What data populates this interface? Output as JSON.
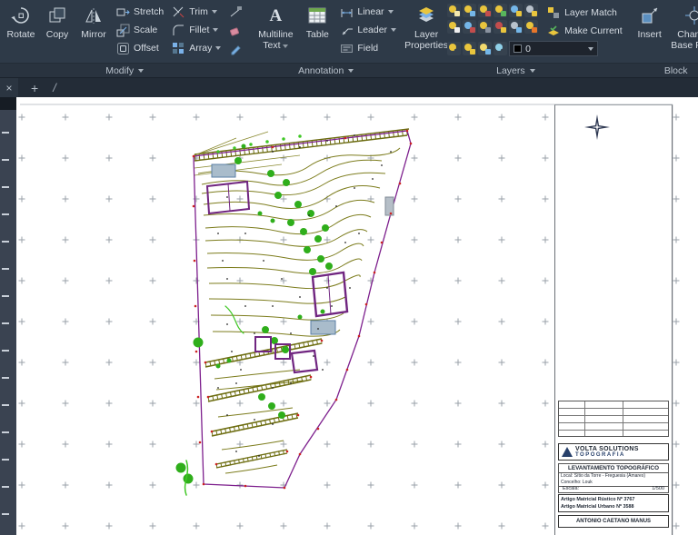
{
  "ribbon": {
    "modify": {
      "label": "Modify",
      "rotate": "Rotate",
      "copy": "Copy",
      "mirror": "Mirror",
      "stretch": "Stretch",
      "scale": "Scale",
      "offset": "Offset",
      "trim": "Trim",
      "fillet": "Fillet",
      "array": "Array"
    },
    "annotation": {
      "label": "Annotation",
      "multiline1": "Multiline",
      "multiline2": "Text",
      "table": "Table",
      "linear": "Linear",
      "leader": "Leader",
      "field": "Field"
    },
    "layers": {
      "label": "Layers",
      "props1": "Layer",
      "props2": "Properties",
      "layer_match": "Layer Match",
      "make_current": "Make Current",
      "current_layer": "0"
    },
    "block": {
      "label": "Block",
      "insert": "Insert",
      "change1": "Change",
      "change2": "Base Point"
    }
  },
  "titleblock": {
    "company_line1": "VOLTA SOLUTIONS",
    "company_line2": "TOPOGRAFIA",
    "drawing_title": "LEVANTAMENTO TOPOGRÁFICO",
    "location_line1": "Local: Sítio da Torre - Freguesia (Amares)",
    "location_line2": "Concelho: Louk",
    "scale_label": "Escala:",
    "scale_value": "1/500",
    "article1": "Artigo Matricial Rústico Nº 3767",
    "article2": "Artigo Matricial Urbano Nº 3588",
    "owner": "ANTONIO CAETANO MANUS"
  }
}
